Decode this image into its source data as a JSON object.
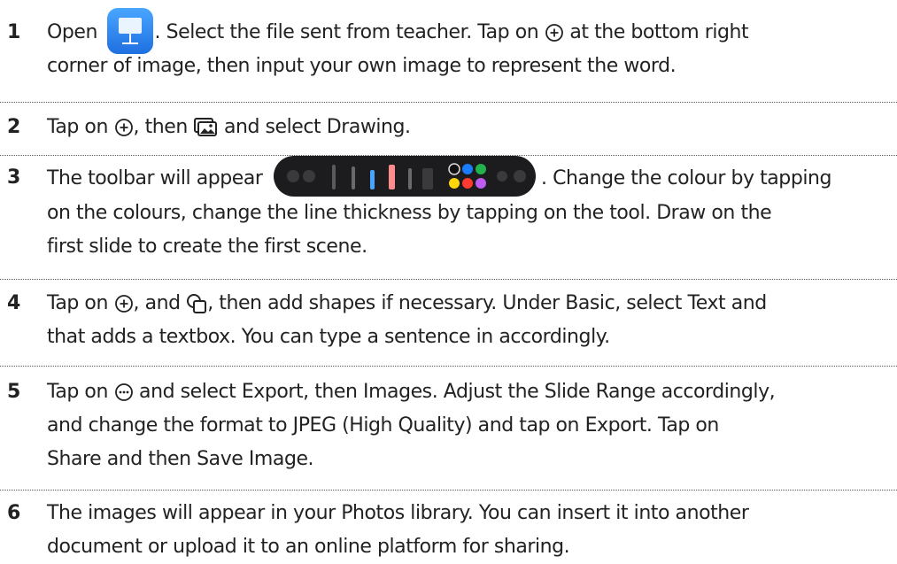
{
  "icons": {
    "plus_circle": "plus-circle-icon",
    "media": "media-icon",
    "shapes": "shapes-icon",
    "more": "more-icon",
    "keynote": "keynote-icon",
    "toolbar": "drawing-toolbar-icon"
  },
  "colors": {
    "text": "#222222",
    "separator": "#5a5a5a",
    "toolbar_bg": "#1c1c1e",
    "keynote_blue": "#1e6fe0",
    "palette": [
      "#111111",
      "#1a7cff",
      "#23b34d",
      "#ffd60a",
      "#ff3b30"
    ]
  },
  "steps": [
    {
      "number": "1",
      "line1_a": "Open",
      "line1_b": ". Select the file sent from teacher. Tap on",
      "line1_c": "at the bottom right",
      "line2": "corner of image, then input your own image to represent the word."
    },
    {
      "number": "2",
      "line1_a": "Tap on",
      "line1_b": ", then",
      "line1_c": "and select Drawing."
    },
    {
      "number": "3",
      "line1_a": "The toolbar will appear",
      "line1_b": ". Change the colour by tapping",
      "line2": "on the colours, change the line thickness by tapping on the tool. Draw on the",
      "line3": "first slide to create the first scene."
    },
    {
      "number": "4",
      "line1_a": "Tap on",
      "line1_b": ", and",
      "line1_c": ", then add shapes if necessary. Under Basic, select Text and",
      "line2": "that adds a textbox. You can type a sentence in accordingly."
    },
    {
      "number": "5",
      "line1_a": "Tap on",
      "line1_b": "and select Export, then Images. Adjust the Slide Range accordingly,",
      "line2": "and change the format to JPEG (High Quality) and tap on Export. Tap on",
      "line3": "Share and then Save Image."
    },
    {
      "number": "6",
      "line1": "The images will appear in your Photos library. You can insert it into another",
      "line2": "document or upload it to an online platform for sharing."
    }
  ]
}
